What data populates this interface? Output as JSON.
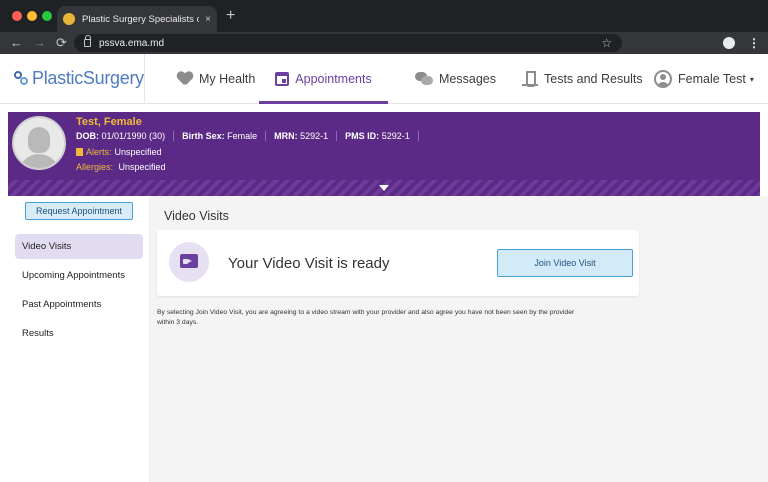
{
  "browser": {
    "tab_title": "Plastic Surgery Specialists of Vi",
    "tab_close": "×",
    "new_tab": "+",
    "url": "pssva.ema.md",
    "back": "←",
    "forward": "→",
    "reload": "⟳",
    "bookmark": "☆",
    "menu": "⋮"
  },
  "header": {
    "logo_text": "PlasticSurgery",
    "nav": {
      "my_health": "My Health",
      "appointments": "Appointments",
      "messages": "Messages",
      "tests_results": "Tests and Results",
      "user": "Female Test"
    },
    "caret": "▾"
  },
  "patient": {
    "name": "Test, Female",
    "dob_label": "DOB:",
    "dob_value": "01/01/1990 (30)",
    "sex_label": "Birth Sex:",
    "sex_value": "Female",
    "mrn_label": "MRN:",
    "mrn_value": "5292-1",
    "pms_label": "PMS ID:",
    "pms_value": "5292-1",
    "alerts_label": "Alerts:",
    "alerts_value": "Unspecified",
    "allergies_label": "Allergies:",
    "allergies_value": "Unspecified"
  },
  "sidebar": {
    "request_button": "Request Appointment",
    "items": [
      {
        "label": "Video Visits",
        "active": true
      },
      {
        "label": "Upcoming Appointments",
        "active": false
      },
      {
        "label": "Past Appointments",
        "active": false
      },
      {
        "label": "Results",
        "active": false
      }
    ]
  },
  "main": {
    "title": "Video Visits",
    "ready_text": "Your Video Visit is ready",
    "join_button": "Join Video Visit",
    "disclaimer": "By selecting Join Video Visit, you are agreeing to a video stream with your provider and also agree you have not been seen by the provider within 3 days."
  },
  "colors": {
    "brand_purple": "#5b2a86",
    "accent_purple": "#6b3fa0",
    "alert_gold": "#f2b83a",
    "button_blue": "#4a9fd5"
  },
  "icons": [
    "heart-pulse-icon",
    "calendar-icon",
    "chat-bubbles-icon",
    "microscope-icon",
    "user-avatar-icon",
    "video-camera-icon",
    "flag-icon",
    "lock-icon",
    "star-icon"
  ]
}
